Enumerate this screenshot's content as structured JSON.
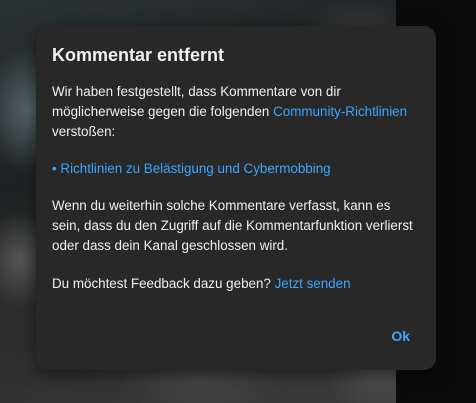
{
  "dialog": {
    "title": "Kommentar entfernt",
    "intro_prefix": "Wir haben festgestellt, dass Kommentare von dir möglicherweise gegen die folgenden",
    "guidelines_link": "Community-Richtlinien",
    "intro_suffix": "verstoßen:",
    "policy_bullet": "• Richtlinien zu Belästigung und Cybermobbing",
    "warning": "Wenn du weiterhin solche Kommentare verfasst, kann es sein, dass du den Zugriff auf die Kommentarfunktion verlierst oder dass dein Kanal geschlossen wird.",
    "feedback_prompt": "Du möchtest Feedback dazu geben?",
    "feedback_link": "Jetzt senden",
    "ok_label": "Ok"
  },
  "colors": {
    "dialog_background": "#282828",
    "text": "#f1f1f1",
    "link": "#3ea6ff"
  }
}
